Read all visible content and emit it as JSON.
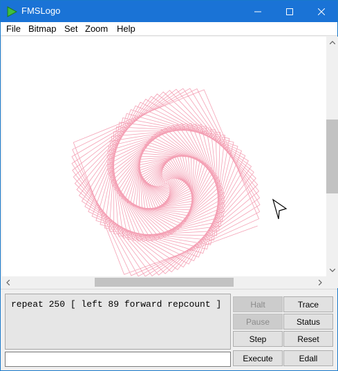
{
  "window": {
    "title": "FMSLogo"
  },
  "menu": [
    "File",
    "Bitmap",
    "Set",
    "Zoom",
    "Help"
  ],
  "canvas": {
    "turtle": "turtle-cursor"
  },
  "commander": {
    "history_text": "repeat 250 [ left 89 forward repcount ]",
    "input_value": ""
  },
  "buttons": {
    "halt": "Halt",
    "trace": "Trace",
    "pause": "Pause",
    "status": "Status",
    "step": "Step",
    "reset": "Reset",
    "execute": "Execute",
    "edall": "Edall"
  },
  "colors": {
    "titlebar": "#1a73d6",
    "spiral": "#f4a0b4",
    "canvas": "#ffffff"
  },
  "icons": {
    "app": "green-play-icon",
    "minimize": "minimize-icon",
    "maximize": "maximize-icon",
    "close": "close-icon"
  }
}
